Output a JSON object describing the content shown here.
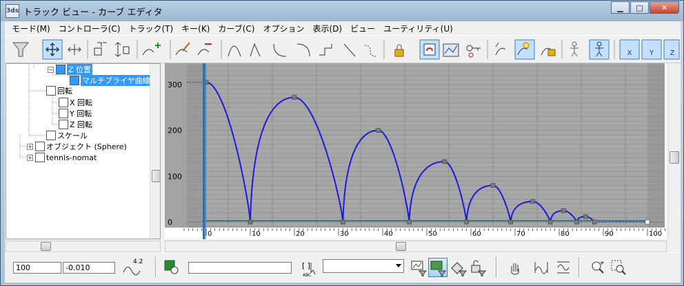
{
  "window": {
    "title": "トラック ビュー - カーブ エディタ",
    "app_icon_text": "M3DS"
  },
  "menu": [
    "モード(M)",
    "コントローラ(C)",
    "トラック(T)",
    "キー(K)",
    "カーブ(C)",
    "オプション",
    "表示(D)",
    "ビュー",
    "ユーティリティ(U)"
  ],
  "tree": {
    "items": [
      {
        "label": "Z 位置",
        "selected": true,
        "icon": "position-track-icon"
      },
      {
        "label": "マルチプライヤ曲線",
        "selected": true,
        "icon": "multiplier-curve-icon"
      },
      {
        "label": "回転",
        "selected": false,
        "icon": "rotation-icon"
      },
      {
        "label": "X 回転",
        "selected": false,
        "icon": "x-rotation-icon"
      },
      {
        "label": "Y 回転",
        "selected": false,
        "icon": "y-rotation-icon"
      },
      {
        "label": "Z 回転",
        "selected": false,
        "icon": "z-rotation-icon"
      },
      {
        "label": "スケール",
        "selected": false,
        "icon": "scale-icon"
      },
      {
        "label": "オブジェクト (Sphere)",
        "selected": false,
        "icon": "object-icon"
      },
      {
        "label": "tennis-nomat",
        "selected": false,
        "icon": "material-icon"
      }
    ]
  },
  "graph": {
    "colors": {
      "background": "#9a9a9a",
      "curve": "#1a1ae0",
      "key": "#7a7a7a",
      "grid": "#8a8a8a",
      "frame_cursor": "#2f6fb0"
    },
    "y_ticks": [
      "300",
      "200",
      "100",
      "0"
    ],
    "x_ticks": [
      "0",
      "10",
      "20",
      "30",
      "40",
      "50",
      "60",
      "70",
      "80",
      "90",
      "100"
    ],
    "current_frame": 0
  },
  "chart_data": {
    "type": "line",
    "title": "",
    "xlabel": "",
    "ylabel": "",
    "xlim": [
      0,
      100
    ],
    "ylim": [
      0,
      300
    ],
    "series": [
      {
        "keys": [
          {
            "x": 0,
            "y": 305
          },
          {
            "x": 10,
            "y": 0
          },
          {
            "x": 20,
            "y": 272
          },
          {
            "x": 31,
            "y": 0
          },
          {
            "x": 39,
            "y": 200
          },
          {
            "x": 46,
            "y": 0
          },
          {
            "x": 54,
            "y": 132
          },
          {
            "x": 59,
            "y": 0
          },
          {
            "x": 65,
            "y": 80
          },
          {
            "x": 69,
            "y": 0
          },
          {
            "x": 74,
            "y": 45
          },
          {
            "x": 78,
            "y": 0
          },
          {
            "x": 81,
            "y": 25
          },
          {
            "x": 84,
            "y": 0
          },
          {
            "x": 86,
            "y": 12
          },
          {
            "x": 88,
            "y": 0
          }
        ]
      }
    ]
  },
  "status": {
    "frame_value": "100",
    "key_value": "-0.010",
    "function_label": "4.2"
  }
}
